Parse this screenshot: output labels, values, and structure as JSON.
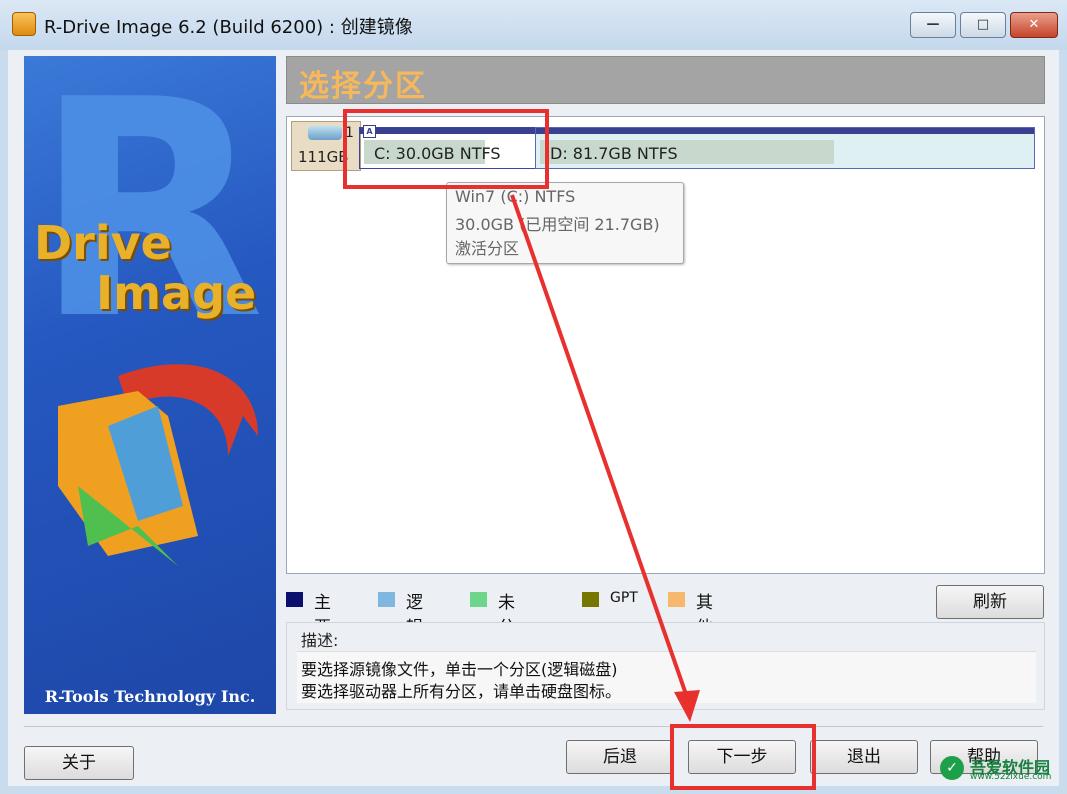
{
  "window": {
    "title": "R-Drive Image 6.2 (Build 6200) : 创建镜像",
    "minimize_glyph": "—",
    "maximize_glyph": "□",
    "close_glyph": "✕"
  },
  "banner": {
    "drive_text": "Drive",
    "image_text": "Image",
    "company": "R-Tools Technology Inc."
  },
  "page_title": "选择分区",
  "disk": {
    "size": "111GB",
    "number": "1",
    "partitions": [
      {
        "label": "C:  30.0GB  NTFS",
        "used_fraction": 0.72
      },
      {
        "label": "D:  81.7GB  NTFS",
        "used_fraction": 0.6
      }
    ],
    "active_marker": "A"
  },
  "tooltip": {
    "line1": "Win7 (C:) NTFS",
    "line2": "30.0GB (已用空间 21.7GB)",
    "line3": "激活分区"
  },
  "legend": [
    {
      "label": "主要",
      "color": "#0b0f6e"
    },
    {
      "label": "逻辑",
      "color": "#7fb7e0"
    },
    {
      "label": "未分配",
      "color": "#6dd68a"
    },
    {
      "label": "GPT",
      "color": "#777700"
    },
    {
      "label": "其他",
      "color": "#f5b86c"
    }
  ],
  "refresh_button": "刷新",
  "description": {
    "label": "描述:",
    "line1": "要选择源镜像文件，单击一个分区(逻辑磁盘)",
    "line2": "要选择驱动器上所有分区，请单击硬盘图标。"
  },
  "buttons": {
    "about": "关于",
    "back": "后退",
    "next": "下一步",
    "exit": "退出",
    "help": "帮助"
  },
  "watermark": {
    "title": "吾爱软件园",
    "url": "www.52zixue.com"
  }
}
